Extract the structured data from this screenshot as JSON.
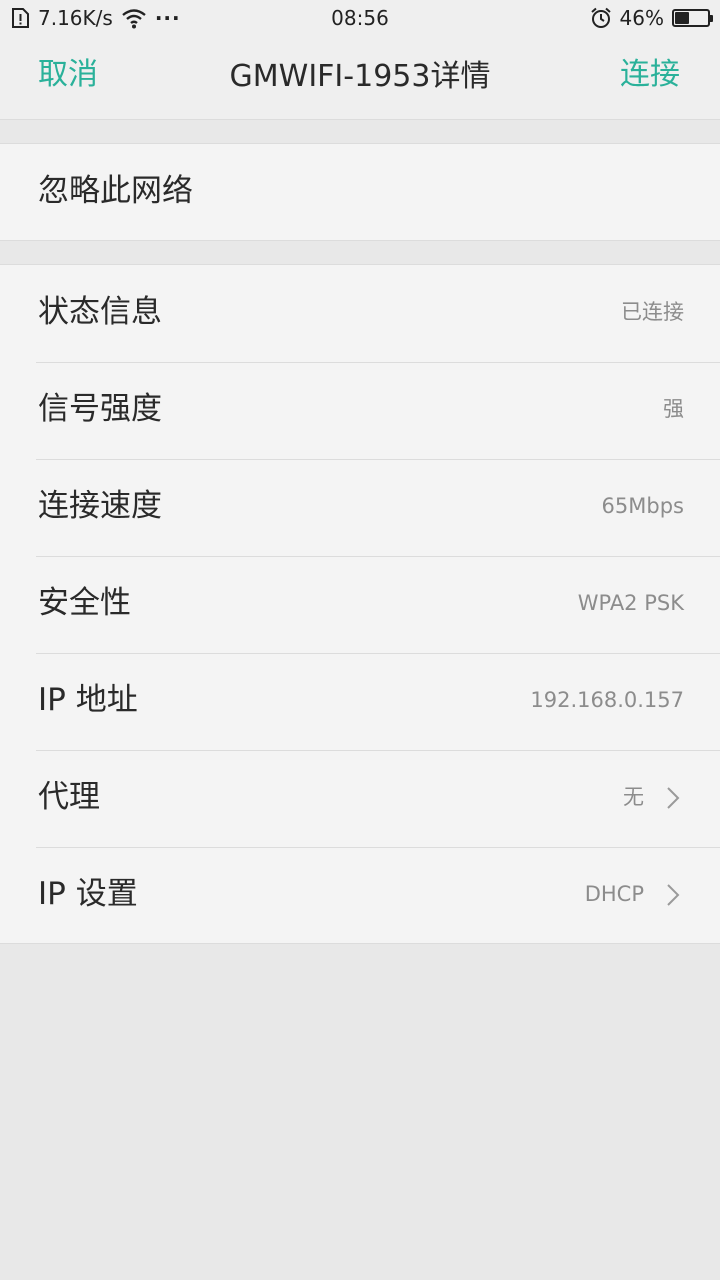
{
  "status_bar": {
    "speed": "7.16K/s",
    "more": "···",
    "time": "08:56",
    "battery_percent": "46%",
    "battery_level": 0.46
  },
  "header": {
    "cancel_label": "取消",
    "title": "GMWIFI-1953详情",
    "connect_label": "连接",
    "accent_color": "#2ab19a"
  },
  "forget": {
    "label": "忽略此网络"
  },
  "details": {
    "status": {
      "label": "状态信息",
      "value": "已连接"
    },
    "signal": {
      "label": "信号强度",
      "value": "强"
    },
    "speed": {
      "label": "连接速度",
      "value": "65Mbps"
    },
    "security": {
      "label": "安全性",
      "value": "WPA2 PSK"
    },
    "ip_address": {
      "label": "IP 地址",
      "value": "192.168.0.157"
    },
    "proxy": {
      "label": "代理",
      "value": "无"
    },
    "ip_settings": {
      "label": "IP 设置",
      "value": "DHCP"
    }
  },
  "icons": [
    "sim-alert-icon",
    "wifi-icon",
    "alarm-icon",
    "battery-icon",
    "chevron-right-icon"
  ]
}
